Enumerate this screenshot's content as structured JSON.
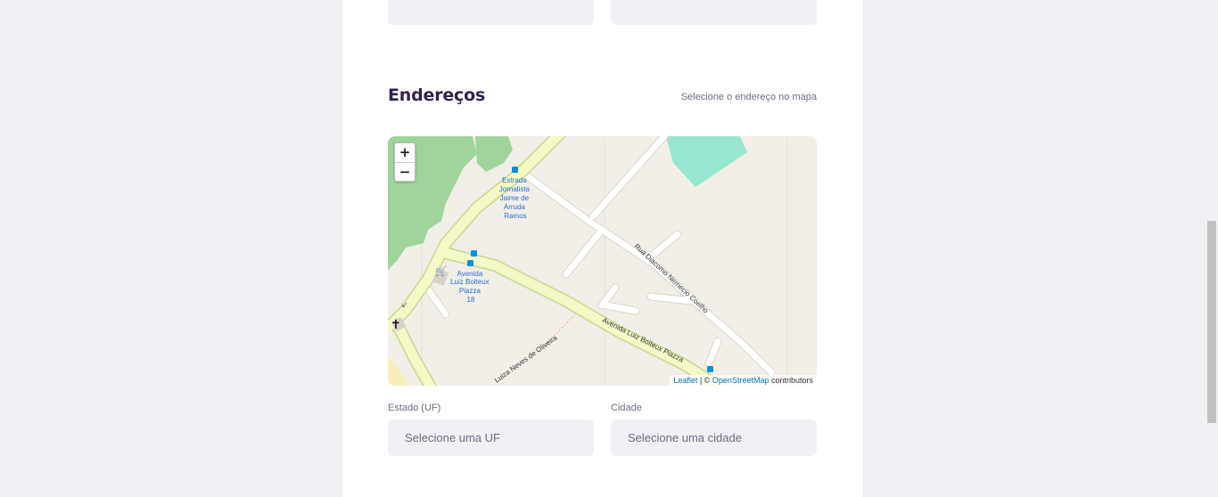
{
  "section": {
    "title": "Endereços",
    "hint": "Selecione o endereço no mapa"
  },
  "map": {
    "zoom_in": "+",
    "zoom_out": "−",
    "attribution": {
      "leaflet": "Leaflet",
      "separator": " | © ",
      "osm": "OpenStreetMap",
      "suffix": " contributors"
    },
    "streets": {
      "rua_diacomo": "Rua Diacomo Nemecio Coelho",
      "avenida_luiz": "Avenida Luiz Boiteux Piazza",
      "luiza_neves": "Luiza Neves de Oliveira"
    },
    "stops": {
      "estrada": [
        "Estrada",
        "Jornalista",
        "Jaime de",
        "Arruda",
        "Ramos"
      ],
      "avenida": [
        "Avenida",
        "Luiz Boiteux",
        "Piazza",
        "18"
      ]
    },
    "colors": {
      "background": "#f2efe9",
      "forest": "#9fd59b",
      "park": "#97e6d1",
      "main_road": "#f5f9c6",
      "main_road_edge": "#c5d88e",
      "minor_road": "#ffffff",
      "label_blue": "#2a6ecc"
    }
  },
  "form": {
    "uf_label": "Estado (UF)",
    "uf_placeholder": "Selecione uma UF",
    "city_label": "Cidade",
    "city_placeholder": "Selecione uma cidade"
  }
}
